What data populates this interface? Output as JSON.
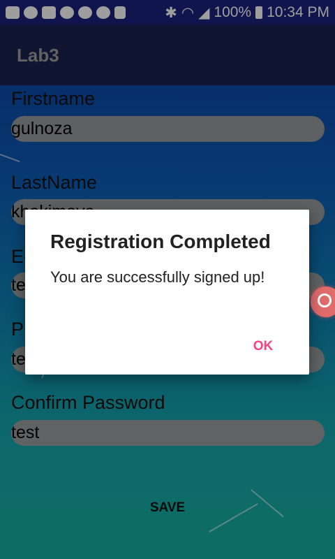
{
  "status_bar": {
    "battery_percent": "100%",
    "time": "10:34 PM",
    "icons": [
      "message-icon",
      "viber-icon",
      "video-icon",
      "chat-icon",
      "chat-icon",
      "chat-icon",
      "cast-icon",
      "bluetooth-icon",
      "wifi-icon",
      "signal-icon",
      "battery-icon"
    ]
  },
  "app_bar": {
    "title": "Lab3"
  },
  "form": {
    "firstname_label": "Firstname",
    "firstname_value": "gulnoza",
    "lastname_label": "LastName",
    "lastname_value": "khakimova",
    "email_label": "E-",
    "email_value": "te",
    "password_label": "P",
    "password_value": "te",
    "confirm_label": "Confirm Password",
    "confirm_value": "test",
    "save_label": "SAVE"
  },
  "dialog": {
    "title": "Registration Completed",
    "message": "You are successfully signed up!",
    "ok_label": "OK"
  },
  "colors": {
    "status_bar": "#1a237e",
    "app_bar": "#1b2450",
    "accent": "#ff4081"
  }
}
